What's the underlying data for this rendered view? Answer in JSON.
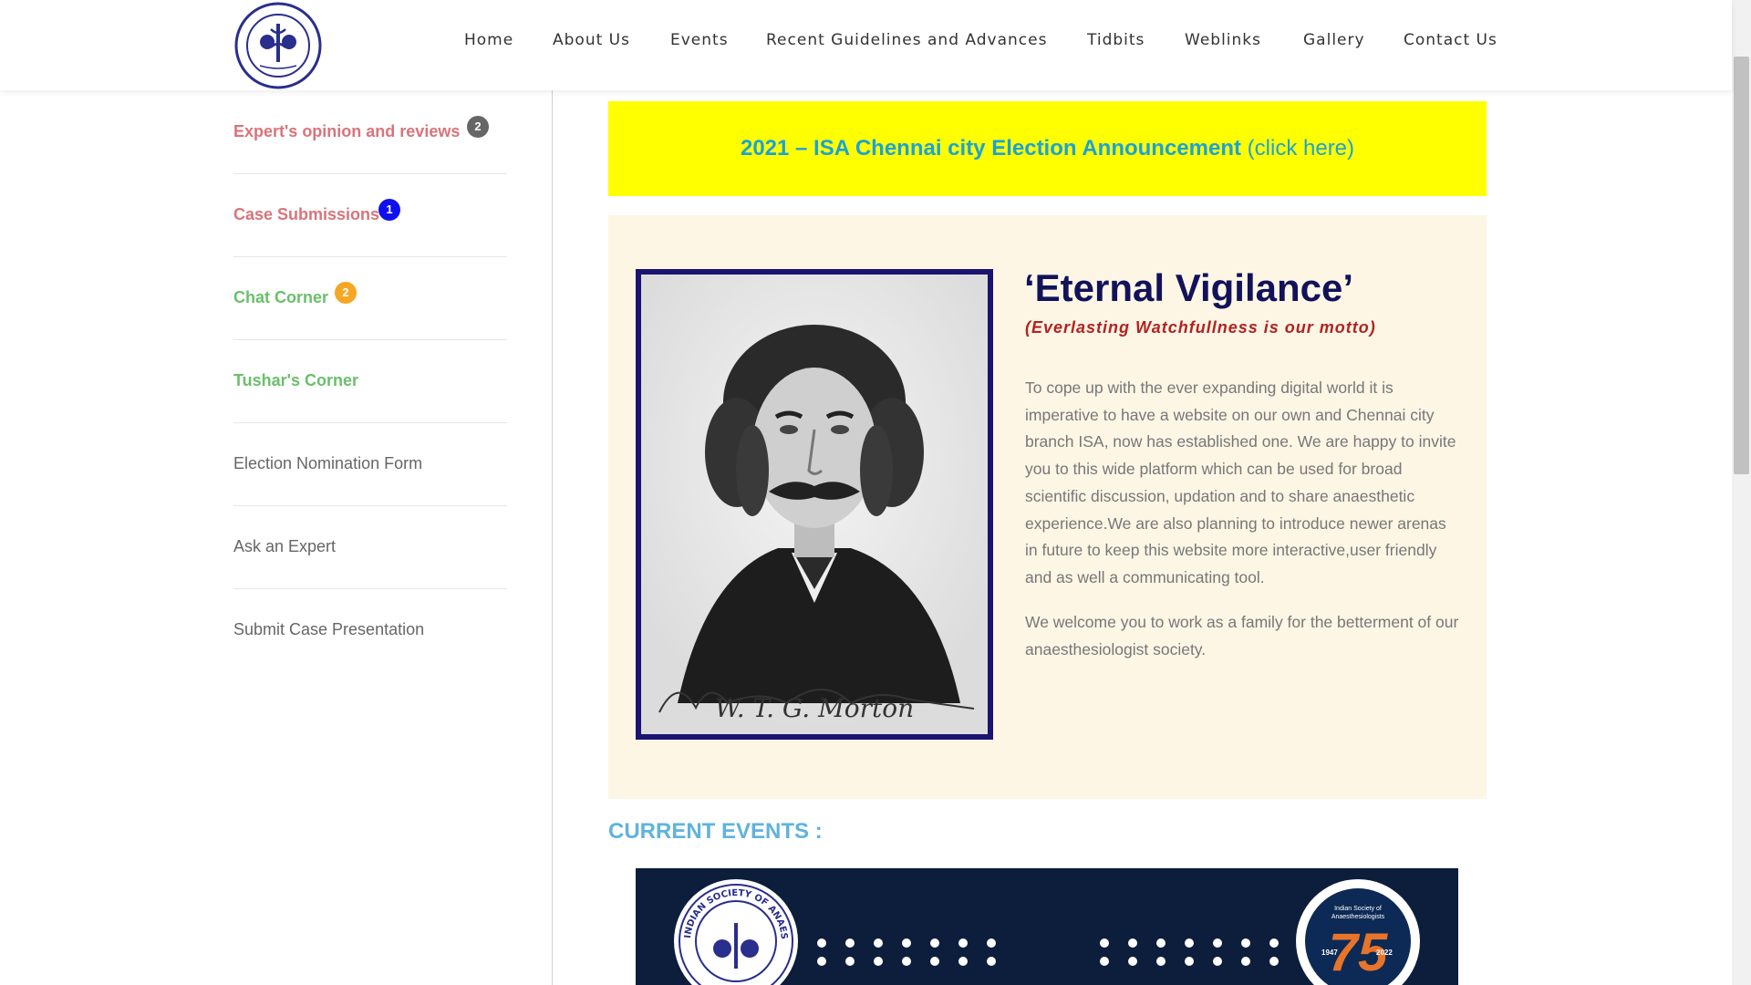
{
  "header": {
    "logo_name": "isa-logo",
    "nav": [
      {
        "label": "Home"
      },
      {
        "label": "About Us"
      },
      {
        "label": "Events"
      },
      {
        "label": "Recent Guidelines and Advances"
      },
      {
        "label": "Tidbits"
      },
      {
        "label": "Weblinks"
      },
      {
        "label": "Gallery"
      },
      {
        "label": "Contact Us"
      }
    ]
  },
  "sidebar": {
    "items": [
      {
        "label": "Expert's opinion and reviews",
        "badge": "2",
        "badge_color": "#666666",
        "style": "red"
      },
      {
        "label": "Case Submissions",
        "badge": "1",
        "badge_color": "#1010ee",
        "style": "red"
      },
      {
        "label": "Chat Corner",
        "badge": "2",
        "badge_color": "#f5a623",
        "style": "green"
      },
      {
        "label": "Tushar's Corner",
        "style": "green"
      },
      {
        "label": "Election Nomination Form",
        "style": "grey"
      },
      {
        "label": "Ask an Expert",
        "style": "grey"
      },
      {
        "label": "Submit Case Presentation",
        "style": "grey"
      }
    ]
  },
  "banner": {
    "title": "2021 – ISA Chennai city Election Announcement",
    "link": "(click here)",
    "bg_color": "#ffff00",
    "text_color": "#1aa3d6"
  },
  "motto": {
    "title": "‘Eternal Vigilance’",
    "subtitle": "(Everlasting Watchfullness is our motto)",
    "para1": "To cope up with the ever expanding digital world it is imperative to have a website on our own and Chennai city branch ISA, now has established one. We are happy to invite you to this wide platform which can be used for broad scientific discussion, updation and to share anaesthetic experience.We are also planning to introduce newer arenas in future to keep this website more interactive,user friendly and as well a communicating tool.",
    "para2": "We welcome you to work as a family for the betterment of our anaesthesiologist society.",
    "signature": "W. T. G. Morton"
  },
  "events": {
    "heading": "CURRENT EVENTS :",
    "left_logo_text": "INDIAN SOCIETY OF ANAESTHESIOLOGISTS",
    "right_logo_line1": "Indian Society of",
    "right_logo_line2": "Anaesthesiologists",
    "right_logo_years_left": "1947",
    "right_logo_years_right": "2022",
    "right_logo_number": "75"
  }
}
